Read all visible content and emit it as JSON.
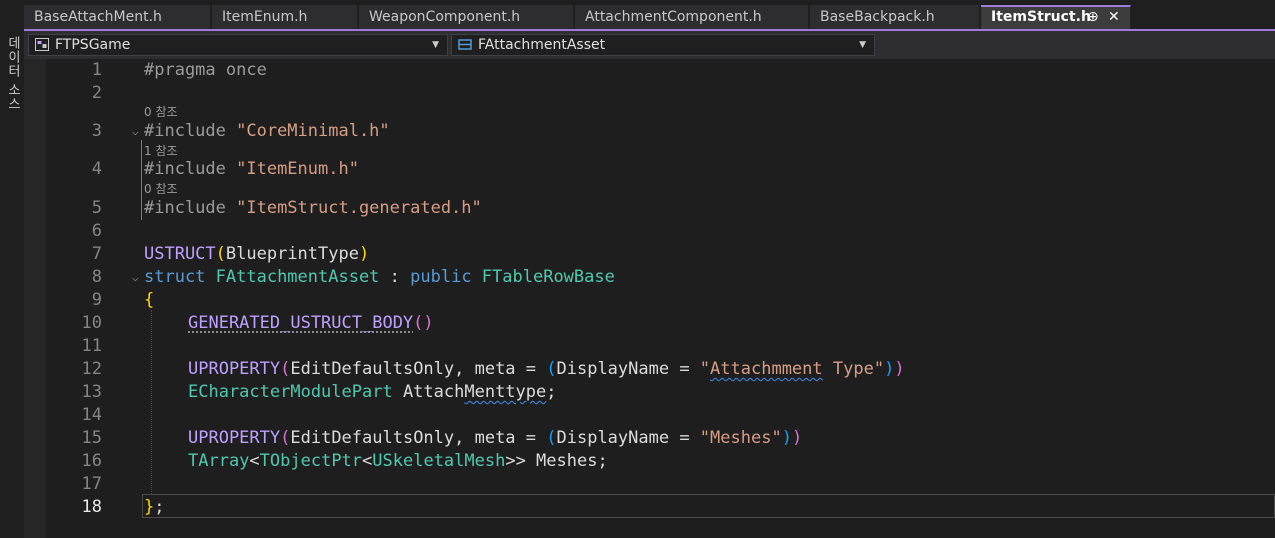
{
  "side_panel": {
    "label": "데이터 소스"
  },
  "tabs": [
    {
      "label": "BaseAttachMent.h",
      "active": false
    },
    {
      "label": "ItemEnum.h",
      "active": false
    },
    {
      "label": "WeaponComponent.h",
      "active": false
    },
    {
      "label": "AttachmentComponent.h",
      "active": false
    },
    {
      "label": "BaseBackpack.h",
      "active": false
    },
    {
      "label": "ItemStruct.h",
      "active": true,
      "pin_icon": "⊕",
      "close_icon": "✕"
    }
  ],
  "navbar": {
    "project": "FTPSGame",
    "scope": "FAttachmentAsset",
    "project_icon": "project-icon",
    "scope_icon": "struct-icon"
  },
  "codelens": {
    "l3": "0 참조",
    "l4": "1 참조",
    "l5": "0 참조"
  },
  "lines": {
    "n1": "1",
    "n2": "2",
    "n3": "3",
    "n4": "4",
    "n5": "5",
    "n6": "6",
    "n7": "7",
    "n8": "8",
    "n9": "9",
    "n10": "10",
    "n11": "11",
    "n12": "12",
    "n13": "13",
    "n14": "14",
    "n15": "15",
    "n16": "16",
    "n17": "17",
    "n18": "18"
  },
  "code": {
    "l1": "#pragma once",
    "l3_dir": "#include ",
    "l3_str": "\"CoreMinimal.h\"",
    "l4_dir": "#include ",
    "l4_str": "\"ItemEnum.h\"",
    "l5_dir": "#include ",
    "l5_str": "\"ItemStruct.generated.h\"",
    "l7_mac": "USTRUCT",
    "l7_p1": "(",
    "l7_arg": "BlueprintType",
    "l7_p2": ")",
    "l8_kw": "struct ",
    "l8_name": "FAttachmentAsset",
    "l8_colon": " : ",
    "l8_pub": "public ",
    "l8_base": "FTableRowBase",
    "l9": "{",
    "l10_mac": "GENERATED_USTRUCT_BODY",
    "l10_par": "()",
    "l12_mac": "UPROPERTY",
    "l12_p1": "(",
    "l12_a": "EditDefaultsOnly, meta = ",
    "l12_p2": "(",
    "l12_b": "DisplayName = ",
    "l12_q1": "\"",
    "l12_s1": "Attachmment",
    "l12_s2": " Type\"",
    "l12_p3": ")",
    "l12_p4": ")",
    "l13_type": "ECharacterModulePart",
    "l13_sp": " Attach",
    "l13_err": "Menttype",
    "l13_end": ";",
    "l15_mac": "UPROPERTY",
    "l15_p1": "(",
    "l15_a": "EditDefaultsOnly, meta = ",
    "l15_p2": "(",
    "l15_b": "DisplayName = ",
    "l15_s": "\"Meshes\"",
    "l15_p3": ")",
    "l15_p4": ")",
    "l16_t1": "TArray",
    "l16_lt1": "<",
    "l16_t2": "TObjectPtr",
    "l16_lt2": "<",
    "l16_t3": "USkeletalMesh",
    "l16_rest": ">> Meshes;",
    "l18_brace": "}",
    "l18_semi": ";"
  },
  "colors": {
    "accent": "#9d7cd8",
    "keyword": "#569cd6",
    "string": "#d69d85",
    "type": "#4ec9b0",
    "macro": "#bea0ff"
  }
}
